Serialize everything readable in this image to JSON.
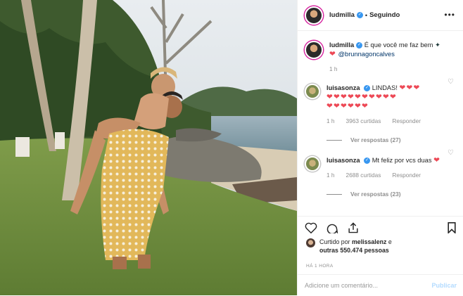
{
  "post": {
    "username": "ludmilla",
    "follow_status": "Seguindo",
    "caption_text": "É que você me faz bem",
    "caption_mention": "@brunnagoncalves",
    "caption_time": "1 h"
  },
  "comments": [
    {
      "username": "luisasonza",
      "text": "LINDAS!",
      "hearts_line1": "❤❤❤",
      "hearts_line2": "❤❤❤❤❤❤❤❤❤❤",
      "hearts_line3": "❤❤❤❤❤❤",
      "time": "1 h",
      "likes": "3963 curtidas",
      "reply_label": "Responder",
      "view_replies": "Ver respostas (27)"
    },
    {
      "username": "luisasonza",
      "text": "Mt feliz por vcs duas",
      "hearts_line1": "❤",
      "time": "1 h",
      "likes": "2688 curtidas",
      "reply_label": "Responder",
      "view_replies": "Ver respostas (23)"
    }
  ],
  "likes_summary": {
    "prefix": "Curtido por",
    "user": "melissalenz",
    "conj": "e",
    "others": "outras 550.474 pessoas"
  },
  "time_ago": "HÁ 1 HORA",
  "comment_box": {
    "placeholder": "Adicione um comentário...",
    "publish": "Publicar"
  },
  "colors": {
    "accent_blue": "#3897f0",
    "heart_red": "#ed4956",
    "muted": "#8e8e8e"
  }
}
